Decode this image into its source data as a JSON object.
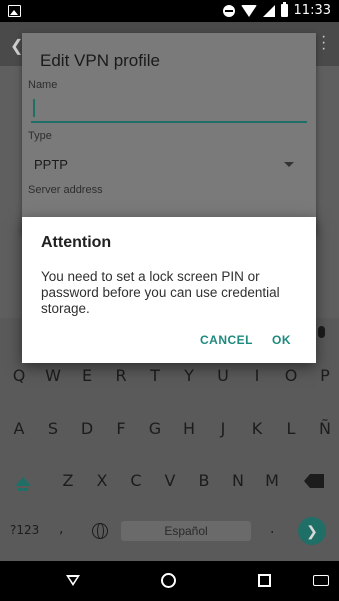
{
  "status_bar": {
    "time": "11:33"
  },
  "vpn_form": {
    "title": "Edit VPN profile",
    "name_label": "Name",
    "name_value": "",
    "type_label": "Type",
    "type_value": "PPTP",
    "server_label": "Server address"
  },
  "dialog": {
    "title": "Attention",
    "message": "You need to set a lock screen PIN or password before you can use credential storage.",
    "cancel_label": "CANCEL",
    "ok_label": "OK"
  },
  "keyboard": {
    "row1": [
      "Q",
      "W",
      "E",
      "R",
      "T",
      "Y",
      "U",
      "I",
      "O",
      "P"
    ],
    "row2": [
      "A",
      "S",
      "D",
      "F",
      "G",
      "H",
      "J",
      "K",
      "L",
      "Ñ"
    ],
    "row3": [
      "Z",
      "X",
      "C",
      "V",
      "B",
      "N",
      "M"
    ],
    "symbols_label": "?123",
    "comma": ",",
    "space_label": "Español",
    "period": "."
  },
  "colors": {
    "accent": "#1f8a7e"
  }
}
